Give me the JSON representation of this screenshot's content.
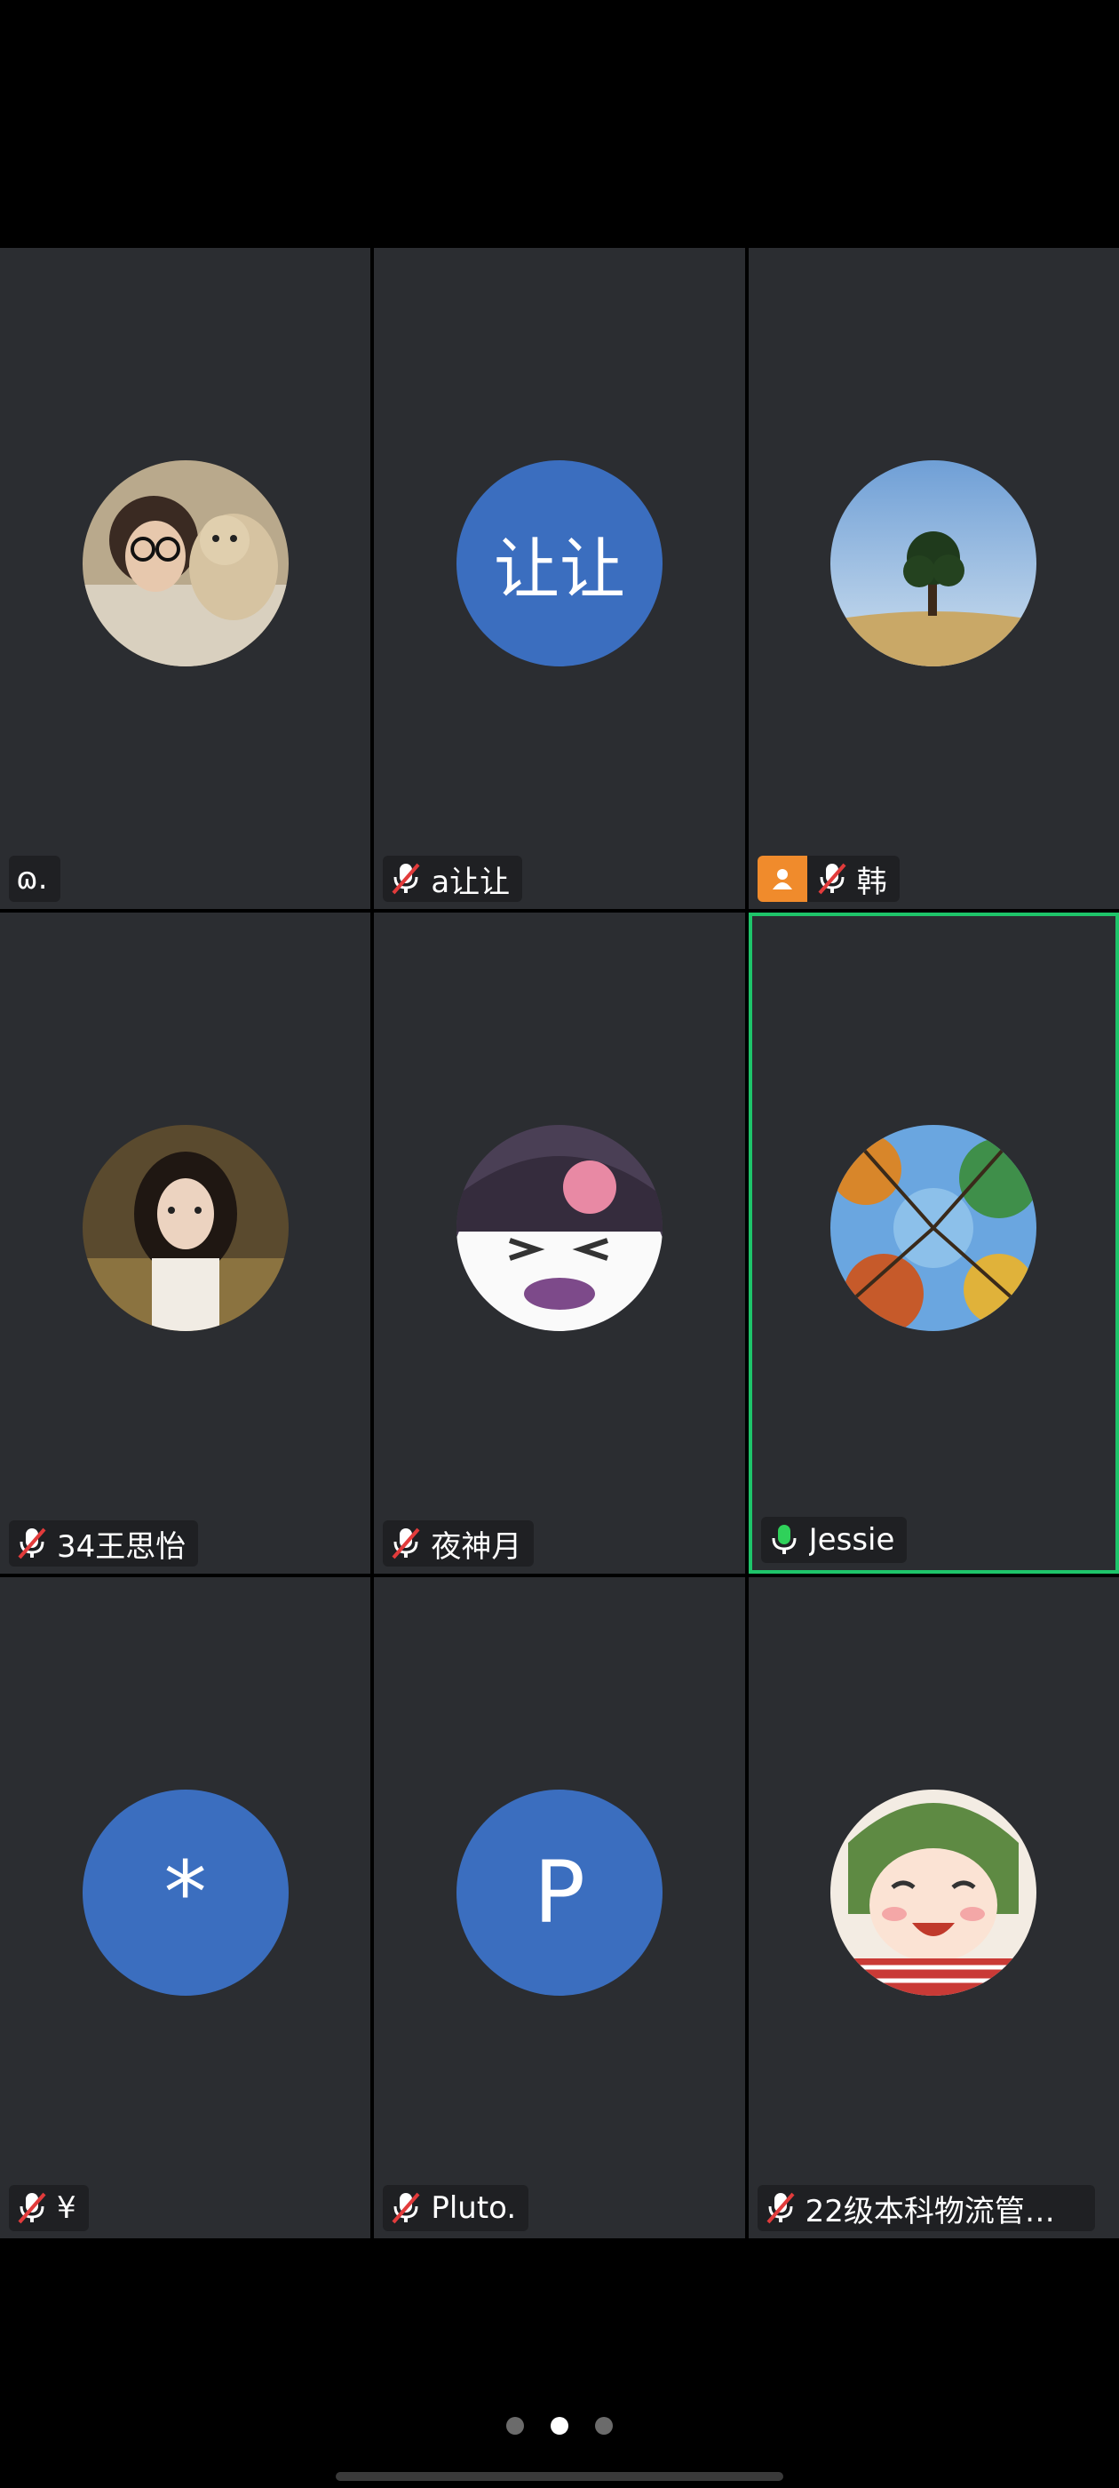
{
  "participants": [
    {
      "name": "ɷ.",
      "avatar": "photo-girl-with-bear",
      "muted": false,
      "mic": "none",
      "host": false,
      "active": false
    },
    {
      "name": "a让让",
      "avatar_text": "让让",
      "muted": true,
      "mic": "muted",
      "host": false,
      "active": false
    },
    {
      "name": "韩",
      "avatar": "photo-tree-sky",
      "muted": true,
      "mic": "muted",
      "host": true,
      "active": false
    },
    {
      "name": "34王思怡",
      "avatar": "photo-girl-portrait",
      "muted": true,
      "mic": "muted",
      "host": false,
      "active": false
    },
    {
      "name": "夜神月",
      "avatar": "photo-kuromi",
      "muted": true,
      "mic": "muted",
      "host": false,
      "active": false
    },
    {
      "name": "Jessie",
      "avatar": "photo-autumn-trees",
      "muted": false,
      "mic": "speaking",
      "host": false,
      "active": true
    },
    {
      "name": "¥",
      "avatar_text": "*",
      "muted": true,
      "mic": "muted",
      "host": false,
      "active": false
    },
    {
      "name": "Pluto.",
      "avatar_text": "P",
      "muted": true,
      "mic": "muted",
      "host": false,
      "active": false
    },
    {
      "name": "22级本科物流管理…",
      "avatar": "photo-anime-girl",
      "muted": true,
      "mic": "muted",
      "host": false,
      "active": false
    }
  ],
  "pagination": {
    "pages": 3,
    "current": 2
  },
  "colors": {
    "tile_bg": "#2b2d31",
    "initials_bg": "#3b6ebf",
    "active_border": "#1ec46a",
    "host_badge": "#f08b2c",
    "mic_muted": "#e23b3b",
    "mic_on": "#2fd15a"
  }
}
